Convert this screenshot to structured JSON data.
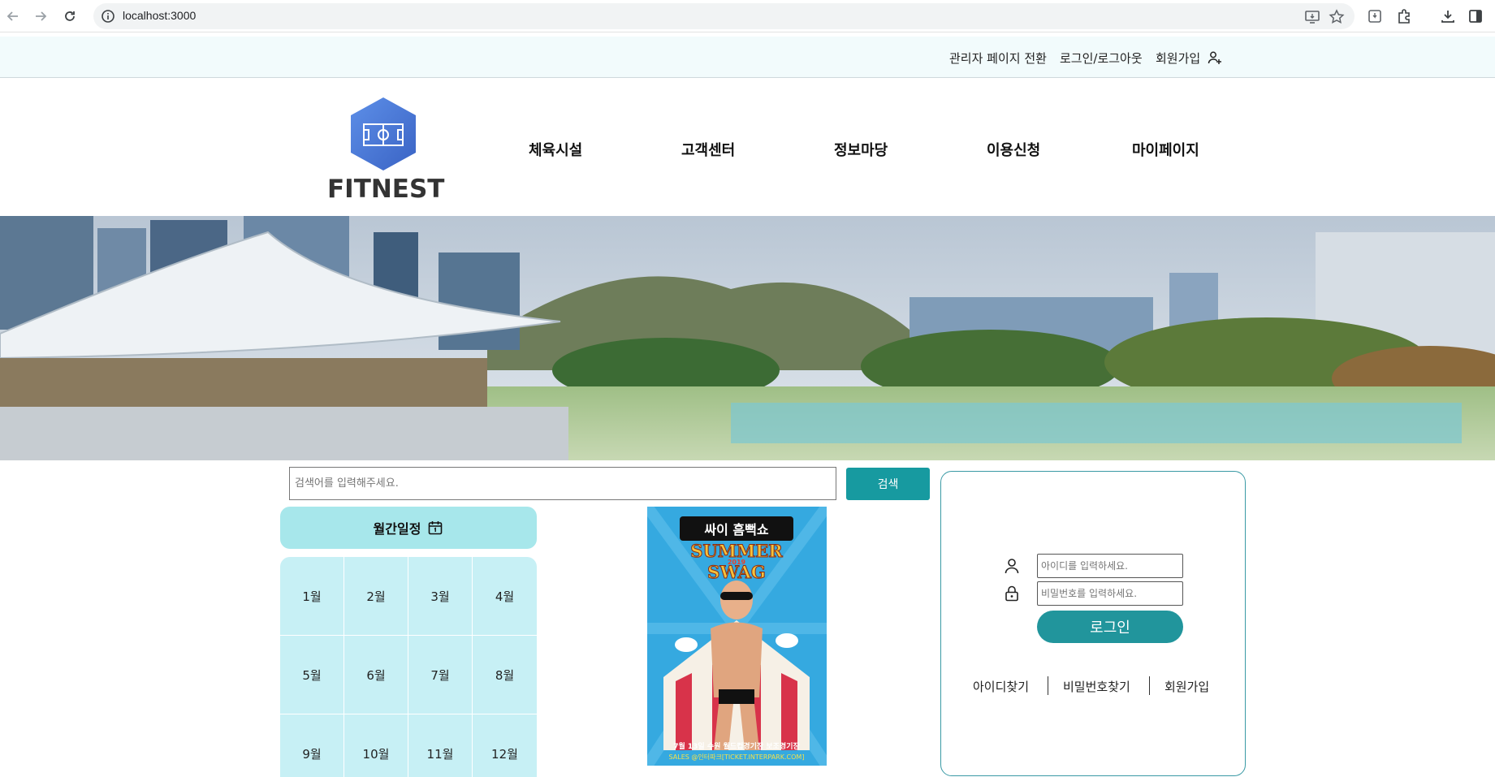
{
  "browser": {
    "url": "localhost:3000"
  },
  "util_bar": {
    "admin_switch": "관리자 페이지 전환",
    "login_logout": "로그인/로그아웃",
    "signup": "회원가입"
  },
  "header": {
    "logo_text": "FITNEST",
    "nav": [
      "체육시설",
      "고객센터",
      "정보마당",
      "이용신청",
      "마이페이지"
    ]
  },
  "search": {
    "placeholder": "검색어를 입력해주세요.",
    "button": "검색"
  },
  "calendar": {
    "title": "월간일정",
    "months": [
      "1월",
      "2월",
      "3월",
      "4월",
      "5월",
      "6월",
      "7월",
      "8월",
      "9월",
      "10월",
      "11월",
      "12월"
    ]
  },
  "poster": {
    "title_top": "싸이 흠뻑쇼",
    "title_mid1": "SUMMER",
    "title_year": "2019",
    "title_mid2": "SWAG",
    "footer_line1": "7월 13일 수원 월드컵경기장 보조경기장",
    "footer_line2": "SALES @인터파크[TICKET.INTERPARK.COM]"
  },
  "login": {
    "id_placeholder": "아이디를 입력하세요.",
    "pw_placeholder": "비밀번호를 입력하세요.",
    "button": "로그인",
    "find_id": "아이디찾기",
    "find_pw": "비밀번호찾기",
    "signup": "회원가입"
  },
  "colors": {
    "accent": "#179aa0",
    "util_bg": "#f2fbfc",
    "calendar_header": "#a7e7eb",
    "calendar_grid": "#c7f0f5",
    "logo_blue": "#4a78d8"
  },
  "icons": [
    "back-arrow-icon",
    "forward-arrow-icon",
    "reload-icon",
    "info-icon",
    "install-icon",
    "star-icon",
    "extension-icon",
    "puzzle-icon",
    "download-icon",
    "sidebar-icon",
    "user-plus-icon",
    "calendar-icon",
    "user-icon",
    "lock-icon"
  ]
}
